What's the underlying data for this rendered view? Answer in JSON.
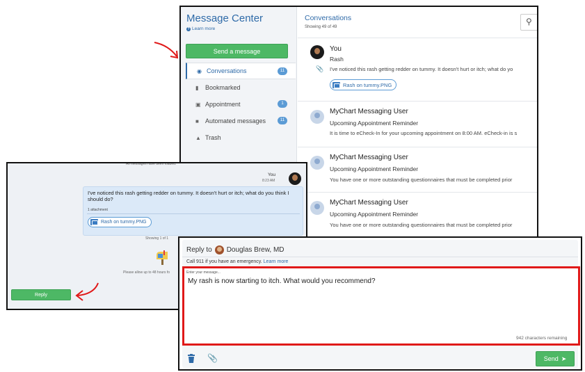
{
  "message_center": {
    "title": "Message Center",
    "learn_more": "Learn more",
    "send_button": "Send a message",
    "menu": [
      {
        "label": "Conversations",
        "icon": "chat-bubble-icon",
        "badge": "11"
      },
      {
        "label": "Bookmarked",
        "icon": "bookmark-icon",
        "badge": ""
      },
      {
        "label": "Appointment",
        "icon": "calendar-icon",
        "badge": "1"
      },
      {
        "label": "Automated messages",
        "icon": "folder-icon",
        "badge": "11"
      },
      {
        "label": "Trash",
        "icon": "trash-icon",
        "badge": ""
      }
    ]
  },
  "conversations": {
    "title": "Conversations",
    "count": "Showing 49 of 49",
    "search_icon": "search-icon",
    "items": [
      {
        "name": "You",
        "subject": "Rash",
        "preview": "I've noticed this rash getting redder on tummy. It doesn't hurt or itch; what do yo",
        "attachment": "Rash on tummy.PNG"
      },
      {
        "name": "MyChart Messaging User",
        "subject": "Upcoming Appointment Reminder",
        "preview": "It is time to eCheck-In for your upcoming appointment on 8:00 AM. eCheck-in is s"
      },
      {
        "name": "MyChart Messaging User",
        "subject": "Upcoming Appointment Reminder",
        "preview": "You have one or more outstanding questionnaires that must be completed prior"
      },
      {
        "name": "MyChart Messaging User",
        "subject": "Upcoming Appointment Reminder",
        "preview": "You have one or more outstanding questionnaires that must be completed prior"
      }
    ]
  },
  "message_detail": {
    "header": "All messages have been loaded.",
    "sender": "You",
    "time": "8:23 AM",
    "body": "I've noticed this rash getting redder on tummy. It doesn't hurt or itch; what do you think I should do?",
    "attachment_count": "1 attachment",
    "attachment": "Rash on tummy.PNG",
    "showing": "Showing 1 of 1",
    "allow_note": "Please allow up to 48 hours fo",
    "reply_button": "Reply"
  },
  "composer": {
    "reply_to_label": "Reply to",
    "recipient": "Douglas Brew, MD",
    "emergency_text": "Call 911 if you have an emergency.",
    "emergency_link": "Learn more",
    "field_label": "Enter your message...",
    "message": "My rash is now starting to itch. What would you recommend?",
    "remaining": "942 characters remaining",
    "send_button": "Send",
    "highlight_color": "#e01919"
  },
  "colors": {
    "accent": "#2e6aa8",
    "button_green": "#4db865",
    "annotation_red": "#e01919"
  }
}
